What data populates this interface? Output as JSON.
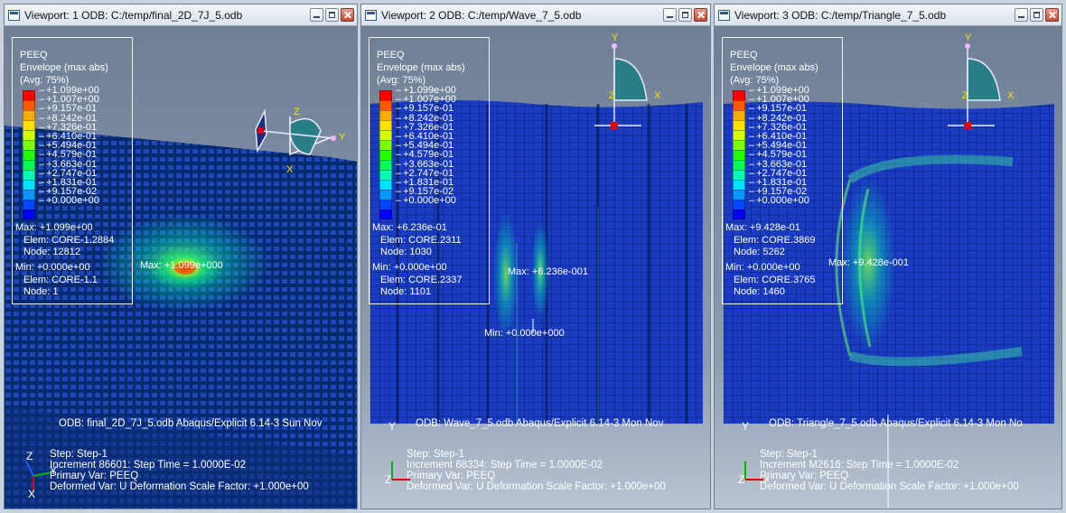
{
  "legend_common": {
    "var": "PEEQ",
    "env": "Envelope (max abs)",
    "avg": "(Avg: 75%)",
    "values": [
      "+1.099e+00",
      "+1.007e+00",
      "+9.157e-01",
      "+8.242e-01",
      "+7.326e-01",
      "+6.410e-01",
      "+5.494e-01",
      "+4.579e-01",
      "+3.663e-01",
      "+2.747e-01",
      "+1.831e-01",
      "+9.157e-02",
      "+0.000e+00"
    ],
    "colors": [
      "#ff0000",
      "#ff5a00",
      "#ffaa00",
      "#ffe100",
      "#d4ff00",
      "#7dff00",
      "#22ff00",
      "#00ff55",
      "#00ffb0",
      "#00e1ff",
      "#0096ff",
      "#0046ff",
      "#0000ff"
    ]
  },
  "viewports": [
    {
      "title": "Viewport: 1   ODB: C:/temp/final_2D_7J_5.odb",
      "max_label": "Max: +1.099e+00",
      "max_elem": "Elem: CORE-1.2884",
      "max_node": "Node: 12812",
      "min_label": "Min: +0.000e+00",
      "min_elem": "Elem: CORE-1.1",
      "min_node": "Node: 1",
      "max_ann": "Max: +1.099e+000",
      "odb_line": "ODB: final_2D_7J_5.odb    Abaqus/Explicit 6.14-3    Sun Nov",
      "step": "Step: Step-1",
      "increment": "Increment     86601: Step Time =   1.0000E-02",
      "primary": "Primary Var: PEEQ",
      "deformed": "Deformed Var: U   Deformation Scale Factor: +1.000e+00",
      "axes": {
        "z": "Z",
        "x": "X",
        "y": "Y"
      }
    },
    {
      "title": "Viewport: 2   ODB: C:/temp/Wave_7_5.odb",
      "max_label": "Max: +6.236e-01",
      "max_elem": "Elem: CORE.2311",
      "max_node": "Node: 1030",
      "min_label": "Min: +0.000e+00",
      "min_elem": "Elem: CORE.2337",
      "min_node": "Node: 1101",
      "max_ann": "Max: +6.236e-001",
      "min_ann": "Min: +0.000e+000",
      "odb_line": "ODB: Wave_7_5.odb    Abaqus/Explicit 6.14-3    Mon Nov",
      "step": "Step: Step-1",
      "increment": "Increment     68334: Step Time =   1.0000E-02",
      "primary": "Primary Var: PEEQ",
      "deformed": "Deformed Var: U   Deformation Scale Factor: +1.000e+00",
      "axes": {
        "y": "Y",
        "z": "Z",
        "x": "X"
      }
    },
    {
      "title": "Viewport: 3   ODB: C:/temp/Triangle_7_5.odb",
      "max_label": "Max: +9.428e-01",
      "max_elem": "Elem: CORE.3869",
      "max_node": "Node: 5262",
      "min_label": "Min: +0.000e+00",
      "min_elem": "Elem: CORE.3765",
      "min_node": "Node: 1460",
      "max_ann": "Max: +9.428e-001",
      "min_ann": "Min: +0.000e+000",
      "odb_line": "ODB: Triangle_7_5.odb    Abaqus/Explicit 6.14-3    Mon No",
      "step": "Step: Step-1",
      "increment": "Increment     M2616: Step Time =   1.0000E-02",
      "primary": "Primary Var: PEEQ",
      "deformed": "Deformed Var: U   Deformation Scale Factor: +1.000e+00",
      "axes": {
        "y": "Y",
        "z": "Z",
        "x": "X"
      }
    }
  ]
}
